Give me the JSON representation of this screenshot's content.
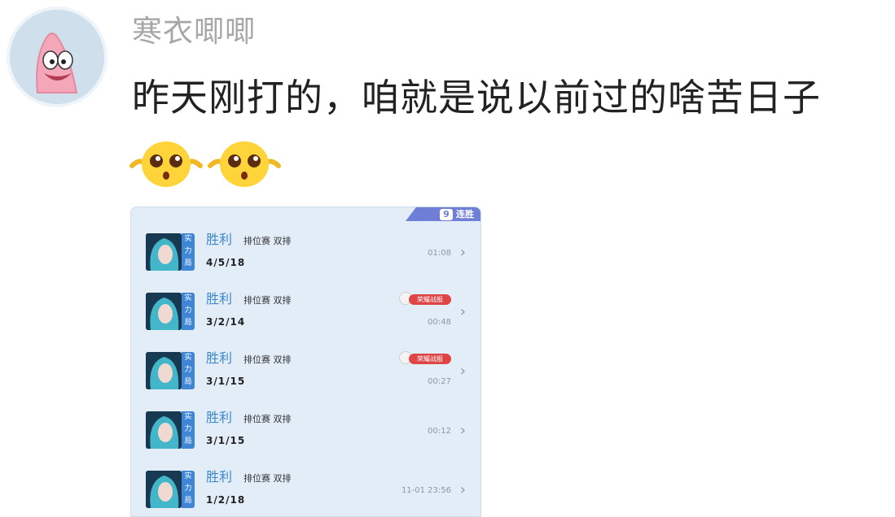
{
  "comment": {
    "username": "寒衣唧唧",
    "text": "昨天刚打的，咱就是说以前过的啥苦日子",
    "emojis": [
      "pleading-face-icon",
      "pleading-face-icon"
    ],
    "avatar_icon": "patrick-star-avatar-icon"
  },
  "screenshot": {
    "tag_number": "9",
    "tag_label": "连胜",
    "badge_label": "实力局",
    "matches": [
      {
        "result": "胜利",
        "mode": "排位赛 双排",
        "kda": "4/5/18",
        "time": "01:08",
        "has_tag": false
      },
      {
        "result": "胜利",
        "mode": "排位赛 双排",
        "kda": "3/2/14",
        "time": "00:48",
        "has_tag": true,
        "tag": "荣耀战报"
      },
      {
        "result": "胜利",
        "mode": "排位赛 双排",
        "kda": "3/1/15",
        "time": "00:27",
        "has_tag": true,
        "tag": "荣耀战报"
      },
      {
        "result": "胜利",
        "mode": "排位赛 双排",
        "kda": "3/1/15",
        "time": "00:12",
        "has_tag": false
      },
      {
        "result": "胜利",
        "mode": "排位赛 双排",
        "kda": "1/2/18",
        "time": "11-01 23:56",
        "has_tag": false
      }
    ]
  },
  "colors": {
    "result": "#3d88c9",
    "badge": "#3f87d6",
    "tag": "#6f7fd8",
    "report_tag": "#e04545"
  }
}
